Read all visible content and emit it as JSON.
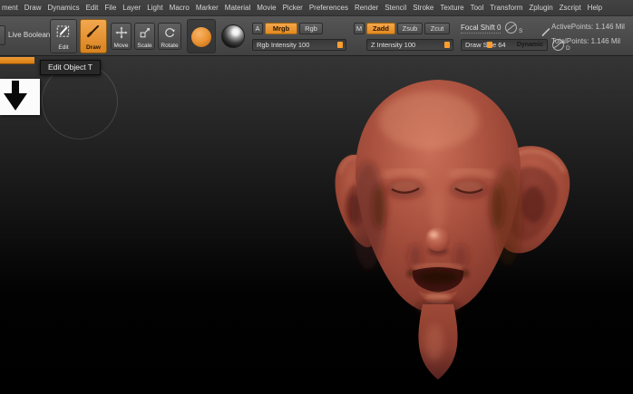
{
  "menu": {
    "items": [
      "ment",
      "Draw",
      "Dynamics",
      "Edit",
      "File",
      "Layer",
      "Light",
      "Macro",
      "Marker",
      "Material",
      "Movie",
      "Picker",
      "Preferences",
      "Render",
      "Stencil",
      "Stroke",
      "Texture",
      "Tool",
      "Transform",
      "Zplugin",
      "Zscript",
      "Help"
    ]
  },
  "toolbar": {
    "live_boolean_label": "Live Boolean",
    "edit_label": "Edit",
    "draw_label": "Draw",
    "move_label": "Move",
    "scale_label": "Scale",
    "rotate_label": "Rotate",
    "channel_a_label": "A",
    "mrgb_label": "Mrgb",
    "rgb_label": "Rgb",
    "m_label": "M",
    "zadd_label": "Zadd",
    "zsub_label": "Zsub",
    "zcut_label": "Zcut",
    "rgb_intensity_label": "Rgb Intensity 100",
    "z_intensity_label": "Z Intensity 100",
    "focal_shift_label": "Focal Shift 0",
    "draw_size_label": "Draw Size 64",
    "dynamic_label": "Dynamic",
    "focal_curve_letter": "S",
    "draw_size_curve_letter": "D",
    "active_points": "ActivePoints: 1.146 Mil",
    "total_points": "TotalPoints: 1.146 Mil"
  },
  "tooltip": {
    "text": "Edit Object T"
  },
  "icons": {
    "edit": "pencil-on-dashed-frame",
    "draw": "brush",
    "move": "four-way-arrows",
    "scale": "box-with-diagonal-arrow",
    "rotate": "circular-arrow",
    "brush_stroke": "filled-orange-circle",
    "material_sphere": "matcap-sphere",
    "focal_curve": "circle-with-curve",
    "draw_size_curve": "circle-with-curve",
    "points_pencil": "pencil",
    "tool_arrow": "black-down-arrow"
  },
  "colors": {
    "accent_orange": "#e9943c",
    "slider_handle": "#ff9d2f",
    "skin_base": "#a85141",
    "canvas_top": "#353535",
    "canvas_bottom": "#000000"
  }
}
